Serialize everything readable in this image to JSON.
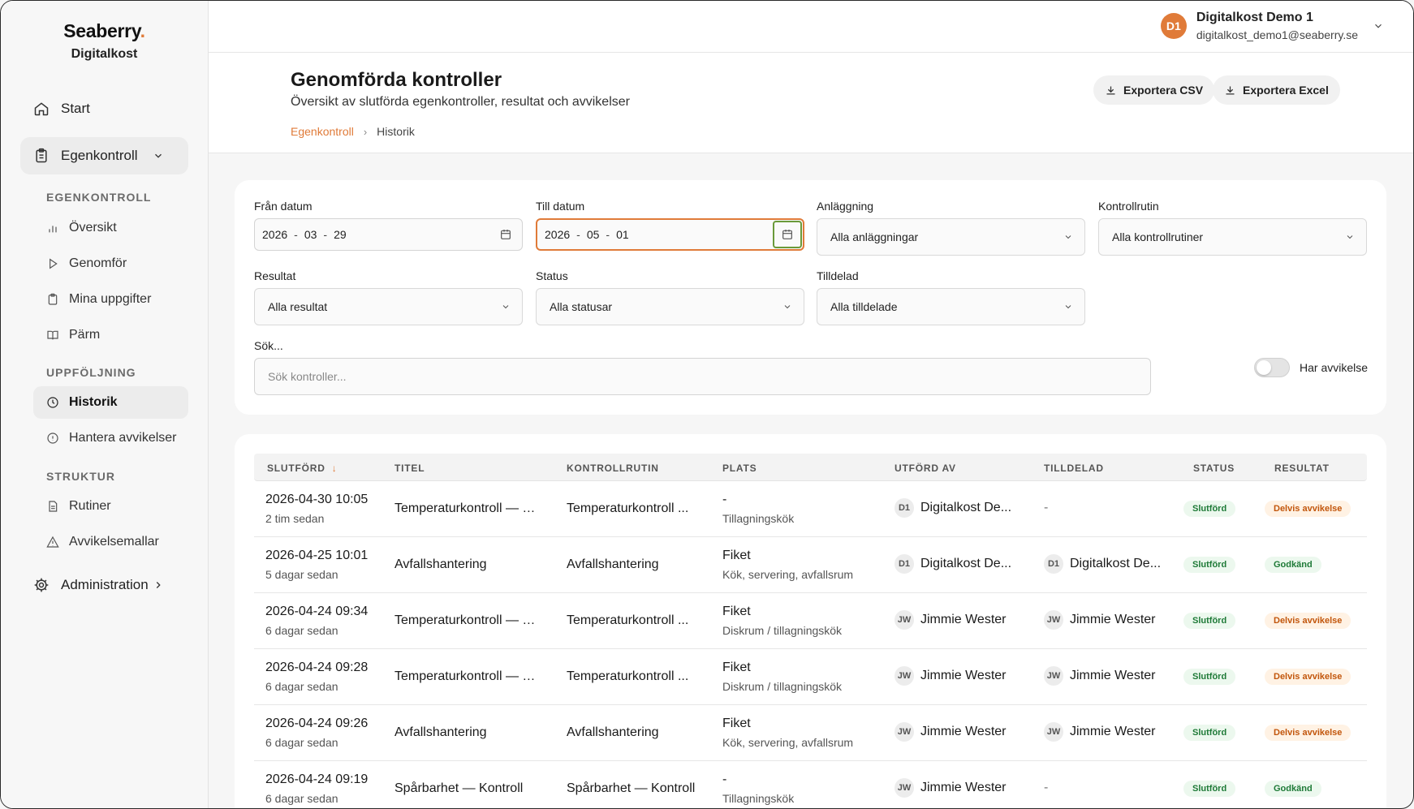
{
  "brand": {
    "name": "Seaberry",
    "dot": ".",
    "product": "Digitalkost"
  },
  "nav": {
    "start": "Start",
    "egenkontroll": "Egenkontroll",
    "section_egen": "EGENKONTROLL",
    "oversikt": "Översikt",
    "genomfor": "Genomför",
    "mina": "Mina uppgifter",
    "parm": "Pärm",
    "section_uppf": "UPPFÖLJNING",
    "historik": "Historik",
    "avvikelser": "Hantera avvikelser",
    "section_struktur": "STRUKTUR",
    "rutiner": "Rutiner",
    "avvikelsemallar": "Avvikelsemallar",
    "administration": "Administration"
  },
  "user": {
    "initials": "D1",
    "name": "Digitalkost Demo 1",
    "email": "digitalkost_demo1@seaberry.se"
  },
  "header": {
    "title": "Genomförda kontroller",
    "subtitle": "Översikt av slutförda egenkontroller, resultat och avvikelser",
    "crumb_link": "Egenkontroll",
    "crumb_current": "Historik",
    "export_csv": "Exportera CSV",
    "export_excel": "Exportera Excel"
  },
  "filters": {
    "from_label": "Från datum",
    "from": {
      "y": "2026",
      "m": "03",
      "d": "29"
    },
    "to_label": "Till datum",
    "to": {
      "y": "2026",
      "m": "05",
      "d": "01"
    },
    "sep": "-",
    "anlaggning_label": "Anläggning",
    "anlaggning_value": "Alla anläggningar",
    "rutin_label": "Kontrollrutin",
    "rutin_value": "Alla kontrollrutiner",
    "resultat_label": "Resultat",
    "resultat_value": "Alla resultat",
    "status_label": "Status",
    "status_value": "Alla statusar",
    "tilldelad_label": "Tilldelad",
    "tilldelad_value": "Alla tilldelade",
    "search_label": "Sök...",
    "search_placeholder": "Sök kontroller...",
    "toggle_label": "Har avvikelse",
    "toggle_on": false
  },
  "table": {
    "headers": {
      "slutford": "SLUTFÖRD",
      "sort_arrow": "↓",
      "titel": "TITEL",
      "rutin": "KONTROLLRUTIN",
      "plats": "PLATS",
      "utford": "UTFÖRD AV",
      "tilldelad": "TILLDELAD",
      "status": "STATUS",
      "resultat": "RESULTAT"
    },
    "rows": [
      {
        "date": "2026-04-30 10:05",
        "ago": "2 tim sedan",
        "title": "Temperaturkontroll — K...",
        "rutin": "Temperaturkontroll ...",
        "plats": "-",
        "plats_sub": "Tillagningskök",
        "by_init": "D1",
        "by": "Digitalkost De...",
        "assigned_init": "",
        "assigned": "-",
        "status": "Slutförd",
        "result": "Delvis avvikelse"
      },
      {
        "date": "2026-04-25 10:01",
        "ago": "5 dagar sedan",
        "title": "Avfallshantering",
        "rutin": "Avfallshantering",
        "plats": "Fiket",
        "plats_sub": "Kök, servering, avfallsrum",
        "by_init": "D1",
        "by": "Digitalkost De...",
        "assigned_init": "D1",
        "assigned": "Digitalkost De...",
        "status": "Slutförd",
        "result": "Godkänd"
      },
      {
        "date": "2026-04-24 09:34",
        "ago": "6 dagar sedan",
        "title": "Temperaturkontroll — D...",
        "rutin": "Temperaturkontroll ...",
        "plats": "Fiket",
        "plats_sub": "Diskrum / tillagningskök",
        "by_init": "JW",
        "by": "Jimmie Wester",
        "assigned_init": "JW",
        "assigned": "Jimmie Wester",
        "status": "Slutförd",
        "result": "Delvis avvikelse"
      },
      {
        "date": "2026-04-24 09:28",
        "ago": "6 dagar sedan",
        "title": "Temperaturkontroll — D...",
        "rutin": "Temperaturkontroll ...",
        "plats": "Fiket",
        "plats_sub": "Diskrum / tillagningskök",
        "by_init": "JW",
        "by": "Jimmie Wester",
        "assigned_init": "JW",
        "assigned": "Jimmie Wester",
        "status": "Slutförd",
        "result": "Delvis avvikelse"
      },
      {
        "date": "2026-04-24 09:26",
        "ago": "6 dagar sedan",
        "title": "Avfallshantering",
        "rutin": "Avfallshantering",
        "plats": "Fiket",
        "plats_sub": "Kök, servering, avfallsrum",
        "by_init": "JW",
        "by": "Jimmie Wester",
        "assigned_init": "JW",
        "assigned": "Jimmie Wester",
        "status": "Slutförd",
        "result": "Delvis avvikelse"
      },
      {
        "date": "2026-04-24 09:19",
        "ago": "6 dagar sedan",
        "title": "Spårbarhet — Kontroll",
        "rutin": "Spårbarhet — Kontroll",
        "plats": "-",
        "plats_sub": "Tillagningskök",
        "by_init": "JW",
        "by": "Jimmie Wester",
        "assigned_init": "",
        "assigned": "-",
        "status": "Slutförd",
        "result": "Godkänd"
      }
    ]
  },
  "colors": {
    "accent": "#e07b39",
    "success": "#1e7a37",
    "warning": "#c2560c"
  }
}
